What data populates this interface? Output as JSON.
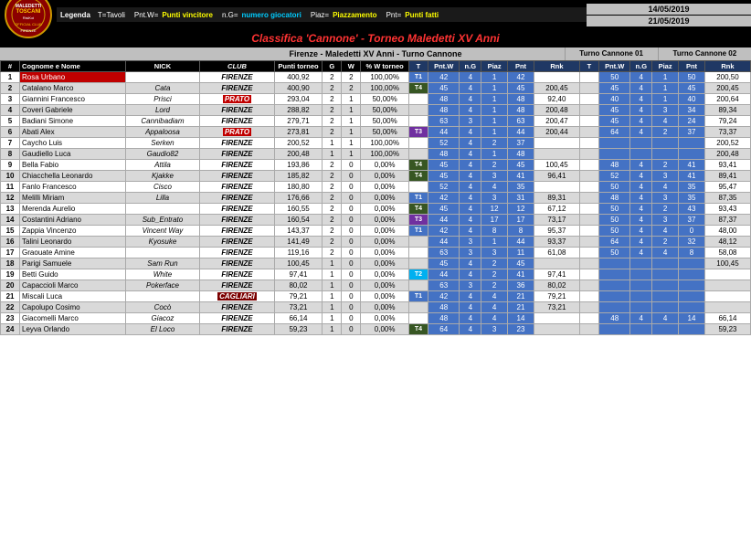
{
  "title": "Classifica 'Cannone' - Torneo Maledetti XV Anni",
  "legend": {
    "label": "Legenda",
    "items": [
      {
        "key": "T=Tavoli"
      },
      {
        "key": "Pnt.W=",
        "highlight": "Punti vincitore"
      },
      {
        "key": "n.G=",
        "highlight2": "numero giocatori"
      },
      {
        "key": "Piaz=",
        "highlight": "Piazzamento"
      },
      {
        "key": "Pnt=",
        "highlight": "Punti fatti"
      }
    ]
  },
  "dates": {
    "start": "14/05/2019",
    "end": "21/05/2019"
  },
  "subtitle": "Firenze - Maledetti XV Anni - Turno Cannone",
  "turno01": "Turno Cannone 01",
  "turno02": "Turno Cannone 02",
  "columns": {
    "num": "#",
    "cognome": "Cognome e Nome",
    "nick": "NICK",
    "club": "CLUB",
    "punti_torneo": "Punti torneo",
    "G": "G",
    "W": "W",
    "perc_torneo": "% W torneo",
    "T": "T",
    "pntw": "Pnt.W",
    "ng": "n.G",
    "piaz": "Piaz",
    "pnt": "Pnt",
    "rnk": "Rnk"
  },
  "rows": [
    {
      "num": 1,
      "cognome": "Rosa Urbano",
      "nick": "",
      "club": "FIRENZE",
      "club_type": "firenze",
      "punti": "400,92",
      "G": 2,
      "W": 2,
      "perc": "100,00%",
      "T": "T1",
      "tc": "t1",
      "pntw1": 42,
      "ng1": 4,
      "piaz1": 1,
      "pnt1": 42,
      "rnk1": "",
      "pntw2": 50,
      "ng2": 4,
      "piaz2": 1,
      "pnt2": 50,
      "rnk2": "200,50",
      "has_t2": true,
      "row_special": true
    },
    {
      "num": 2,
      "cognome": "Catalano Marco",
      "nick": "Cata",
      "club": "FIRENZE",
      "club_type": "firenze",
      "punti": "400,90",
      "G": 2,
      "W": 2,
      "perc": "100,00%",
      "T": "T4",
      "tc": "t4",
      "pntw1": 45,
      "ng1": 4,
      "piaz1": 1,
      "pnt1": 45,
      "rnk1": "200,45",
      "pntw2": 45,
      "ng2": 4,
      "piaz2": 1,
      "pnt2": 45,
      "rnk2": "200,45",
      "has_t2": true
    },
    {
      "num": 3,
      "cognome": "Giannini Francesco",
      "nick": "Prisci",
      "club": "PRATO",
      "club_type": "prato",
      "punti": "293,04",
      "G": 2,
      "W": 1,
      "perc": "50,00%",
      "T": "",
      "tc": "",
      "pntw1": 48,
      "ng1": 4,
      "piaz1": 1,
      "pnt1": 48,
      "rnk1": "92,40",
      "pntw2": 40,
      "ng2": 4,
      "piaz2": 1,
      "pnt2": 40,
      "rnk2": "200,64",
      "has_t2": true
    },
    {
      "num": 4,
      "cognome": "Coveri Gabriele",
      "nick": "Lord",
      "club": "FIRENZE",
      "club_type": "firenze",
      "punti": "288,82",
      "G": 2,
      "W": 1,
      "perc": "50,00%",
      "T": "",
      "tc": "",
      "pntw1": 48,
      "ng1": 4,
      "piaz1": 1,
      "pnt1": 48,
      "rnk1": "200,48",
      "pntw2": 45,
      "ng2": 4,
      "piaz2": 3,
      "pnt2": 34,
      "rnk2": "89,34",
      "has_t2": true
    },
    {
      "num": 5,
      "cognome": "Badiani Simone",
      "nick": "Cannibadiam",
      "club": "FIRENZE",
      "club_type": "firenze",
      "punti": "279,71",
      "G": 2,
      "W": 1,
      "perc": "50,00%",
      "T": "",
      "tc": "",
      "pntw1": 63,
      "ng1": 3,
      "piaz1": 1,
      "pnt1": 63,
      "rnk1": "200,47",
      "pntw2": 45,
      "ng2": 4,
      "piaz2": 4,
      "pnt2": 24,
      "rnk2": "79,24",
      "has_t2": true
    },
    {
      "num": 6,
      "cognome": "Abati Alex",
      "nick": "Appaloosa",
      "club": "PRATO",
      "club_type": "prato",
      "punti": "273,81",
      "G": 2,
      "W": 1,
      "perc": "50,00%",
      "T": "T3",
      "tc": "t3",
      "pntw1": 44,
      "ng1": 4,
      "piaz1": 1,
      "pnt1": 44,
      "rnk1": "200,44",
      "pntw2": 64,
      "ng2": 4,
      "piaz2": 2,
      "pnt2": 37,
      "rnk2": "73,37",
      "has_t2": true
    },
    {
      "num": 7,
      "cognome": "Caycho Luis",
      "nick": "Serken",
      "club": "FIRENZE",
      "club_type": "firenze",
      "punti": "200,52",
      "G": 1,
      "W": 1,
      "perc": "100,00%",
      "T": "",
      "tc": "",
      "pntw1": 52,
      "ng1": 4,
      "piaz1": 2,
      "pnt1": 37,
      "rnk1": "",
      "pntw2": "",
      "ng2": "",
      "piaz2": "",
      "pnt2": "",
      "rnk2": "200,52",
      "has_t2": false
    },
    {
      "num": 8,
      "cognome": "Gaudiello Luca",
      "nick": "Gaudio82",
      "club": "FIRENZE",
      "club_type": "firenze",
      "punti": "200,48",
      "G": 1,
      "W": 1,
      "perc": "100,00%",
      "T": "",
      "tc": "",
      "pntw1": 48,
      "ng1": 4,
      "piaz1": 1,
      "pnt1": 48,
      "rnk1": "",
      "pntw2": "",
      "ng2": "",
      "piaz2": "",
      "pnt2": "",
      "rnk2": "200,48",
      "has_t2": false
    },
    {
      "num": 9,
      "cognome": "Bella Fabio",
      "nick": "Attila",
      "club": "FIRENZE",
      "club_type": "firenze",
      "punti": "193,86",
      "G": 2,
      "W": 0,
      "perc": "0,00%",
      "T": "T4",
      "tc": "t4",
      "pntw1": 45,
      "ng1": 4,
      "piaz1": 2,
      "pnt1": 45,
      "rnk1": "100,45",
      "pntw2": 48,
      "ng2": 4,
      "piaz2": 2,
      "pnt2": 41,
      "rnk2": "93,41",
      "has_t2": true
    },
    {
      "num": 10,
      "cognome": "Chiacchella Leonardo",
      "nick": "Kjakke",
      "club": "FIRENZE",
      "club_type": "firenze",
      "punti": "185,82",
      "G": 2,
      "W": 0,
      "perc": "0,00%",
      "T": "T4",
      "tc": "t4",
      "pntw1": 45,
      "ng1": 4,
      "piaz1": 3,
      "pnt1": 41,
      "rnk1": "96,41",
      "pntw2": 52,
      "ng2": 4,
      "piaz2": 3,
      "pnt2": 41,
      "rnk2": "89,41",
      "has_t2": true
    },
    {
      "num": 11,
      "cognome": "Fanlo Francesco",
      "nick": "Cisco",
      "club": "FIRENZE",
      "club_type": "firenze",
      "punti": "180,80",
      "G": 2,
      "W": 0,
      "perc": "0,00%",
      "T": "",
      "tc": "",
      "pntw1": 52,
      "ng1": 4,
      "piaz1": 4,
      "pnt1": 35,
      "rnk1": "",
      "pntw2": 50,
      "ng2": 4,
      "piaz2": 4,
      "pnt2": 35,
      "rnk2": "95,47",
      "has_t2": true
    },
    {
      "num": 12,
      "cognome": "Melilli Miriam",
      "nick": "Lilla",
      "club": "FIRENZE",
      "club_type": "firenze",
      "punti": "176,66",
      "G": 2,
      "W": 0,
      "perc": "0,00%",
      "T": "T1",
      "tc": "t1",
      "pntw1": 42,
      "ng1": 4,
      "piaz1": 3,
      "pnt1": 31,
      "rnk1": "89,31",
      "pntw2": 48,
      "ng2": 4,
      "piaz2": 3,
      "pnt2": 35,
      "rnk2": "87,35",
      "has_t2": true
    },
    {
      "num": 13,
      "cognome": "Merenda Aurelio",
      "nick": "",
      "club": "FIRENZE",
      "club_type": "firenze",
      "punti": "160,55",
      "G": 2,
      "W": 0,
      "perc": "0,00%",
      "T": "T4",
      "tc": "t4",
      "pntw1": 45,
      "ng1": 4,
      "piaz1": 12,
      "pnt1": 12,
      "rnk1": "67,12",
      "pntw2": 50,
      "ng2": 4,
      "piaz2": 2,
      "pnt2": 43,
      "rnk2": "93,43",
      "has_t2": true
    },
    {
      "num": 14,
      "cognome": "Costantini Adriano",
      "nick": "Sub_Entrato",
      "club": "FIRENZE",
      "club_type": "firenze",
      "punti": "160,54",
      "G": 2,
      "W": 0,
      "perc": "0,00%",
      "T": "T3",
      "tc": "t3",
      "pntw1": 44,
      "ng1": 4,
      "piaz1": 17,
      "pnt1": 17,
      "rnk1": "73,17",
      "pntw2": 50,
      "ng2": 4,
      "piaz2": 3,
      "pnt2": 37,
      "rnk2": "87,37",
      "has_t2": true
    },
    {
      "num": 15,
      "cognome": "Zappia Vincenzo",
      "nick": "Vincent Way",
      "club": "FIRENZE",
      "club_type": "firenze",
      "punti": "143,37",
      "G": 2,
      "W": 0,
      "perc": "0,00%",
      "T": "T1",
      "tc": "t1",
      "pntw1": 42,
      "ng1": 4,
      "piaz1": 8,
      "pnt1": 8,
      "rnk1": "95,37",
      "pntw2": 50,
      "ng2": 4,
      "piaz2": 4,
      "pnt2": 0,
      "rnk2": "48,00",
      "has_t2": true
    },
    {
      "num": 16,
      "cognome": "Talini Leonardo",
      "nick": "Kyosuke",
      "club": "FIRENZE",
      "club_type": "firenze",
      "punti": "141,49",
      "G": 2,
      "W": 0,
      "perc": "0,00%",
      "T": "",
      "tc": "",
      "pntw1": 44,
      "ng1": 3,
      "piaz1": 1,
      "pnt1": 44,
      "rnk1": "93,37",
      "pntw2": 64,
      "ng2": 4,
      "piaz2": 2,
      "pnt2": 32,
      "rnk2": "48,12",
      "has_t2": true
    },
    {
      "num": 17,
      "cognome": "Graouate Amine",
      "nick": "",
      "club": "FIRENZE",
      "club_type": "firenze",
      "punti": "119,16",
      "G": 2,
      "W": 0,
      "perc": "0,00%",
      "T": "",
      "tc": "",
      "pntw1": 63,
      "ng1": 3,
      "piaz1": 3,
      "pnt1": 11,
      "rnk1": "61,08",
      "pntw2": 50,
      "ng2": 4,
      "piaz2": 4,
      "pnt2": 8,
      "rnk2": "58,08",
      "has_t2": true
    },
    {
      "num": 18,
      "cognome": "Parigi Samuele",
      "nick": "Sam Run",
      "club": "FIRENZE",
      "club_type": "firenze",
      "punti": "100,45",
      "G": 1,
      "W": 0,
      "perc": "0,00%",
      "T": "",
      "tc": "",
      "pntw1": 45,
      "ng1": 4,
      "piaz1": 2,
      "pnt1": 45,
      "rnk1": "",
      "pntw2": "",
      "ng2": "",
      "piaz2": "",
      "pnt2": "",
      "rnk2": "100,45",
      "has_t2": false
    },
    {
      "num": 19,
      "cognome": "Betti Guido",
      "nick": "White",
      "club": "FIRENZE",
      "club_type": "firenze",
      "punti": "97,41",
      "G": 1,
      "W": 0,
      "perc": "0,00%",
      "T": "T2",
      "tc": "t2",
      "pntw1": 44,
      "ng1": 4,
      "piaz1": 2,
      "pnt1": 41,
      "rnk1": "97,41",
      "pntw2": "",
      "ng2": "",
      "piaz2": "",
      "pnt2": "",
      "rnk2": "",
      "has_t2": false
    },
    {
      "num": 20,
      "cognome": "Capaccioli Marco",
      "nick": "Pokerface",
      "club": "FIRENZE",
      "club_type": "firenze",
      "punti": "80,02",
      "G": 1,
      "W": 0,
      "perc": "0,00%",
      "T": "",
      "tc": "",
      "pntw1": 63,
      "ng1": 3,
      "piaz1": 2,
      "pnt1": 36,
      "rnk1": "80,02",
      "pntw2": "",
      "ng2": "",
      "piaz2": "",
      "pnt2": "",
      "rnk2": "",
      "has_t2": false
    },
    {
      "num": 21,
      "cognome": "Miscali Luca",
      "nick": "",
      "club": "CAGLIARI",
      "club_type": "cagliari",
      "punti": "79,21",
      "G": 1,
      "W": 0,
      "perc": "0,00%",
      "T": "T1",
      "tc": "t1",
      "pntw1": 42,
      "ng1": 4,
      "piaz1": 4,
      "pnt1": 21,
      "rnk1": "79,21",
      "pntw2": "",
      "ng2": "",
      "piaz2": "",
      "pnt2": "",
      "rnk2": "",
      "has_t2": false
    },
    {
      "num": 22,
      "cognome": "Capolupo Cosimo",
      "nick": "Cocò",
      "club": "FIRENZE",
      "club_type": "firenze",
      "punti": "73,21",
      "G": 1,
      "W": 0,
      "perc": "0,00%",
      "T": "",
      "tc": "",
      "pntw1": 48,
      "ng1": 4,
      "piaz1": 4,
      "pnt1": 21,
      "rnk1": "73,21",
      "pntw2": "",
      "ng2": "",
      "piaz2": "",
      "pnt2": "",
      "rnk2": "",
      "has_t2": false
    },
    {
      "num": 23,
      "cognome": "Giacomelli Marco",
      "nick": "Giacoz",
      "club": "FIRENZE",
      "club_type": "firenze",
      "punti": "66,14",
      "G": 1,
      "W": 0,
      "perc": "0,00%",
      "T": "",
      "tc": "",
      "pntw1": 48,
      "ng1": 4,
      "piaz1": 4,
      "pnt1": 14,
      "rnk1": "",
      "pntw2": 48,
      "ng2": 4,
      "piaz2": 4,
      "pnt2": 14,
      "rnk2": "66,14",
      "has_t2": true
    },
    {
      "num": 24,
      "cognome": "Leyva Orlando",
      "nick": "El Loco",
      "club": "FIRENZE",
      "club_type": "firenze",
      "punti": "59,23",
      "G": 1,
      "W": 0,
      "perc": "0,00%",
      "T": "T4",
      "tc": "t4",
      "pntw1": 64,
      "ng1": 4,
      "piaz1": 3,
      "pnt1": 23,
      "rnk1": "",
      "pntw2": "",
      "ng2": "",
      "piaz2": "",
      "pnt2": "",
      "rnk2": "59,23",
      "has_t2": false
    }
  ]
}
